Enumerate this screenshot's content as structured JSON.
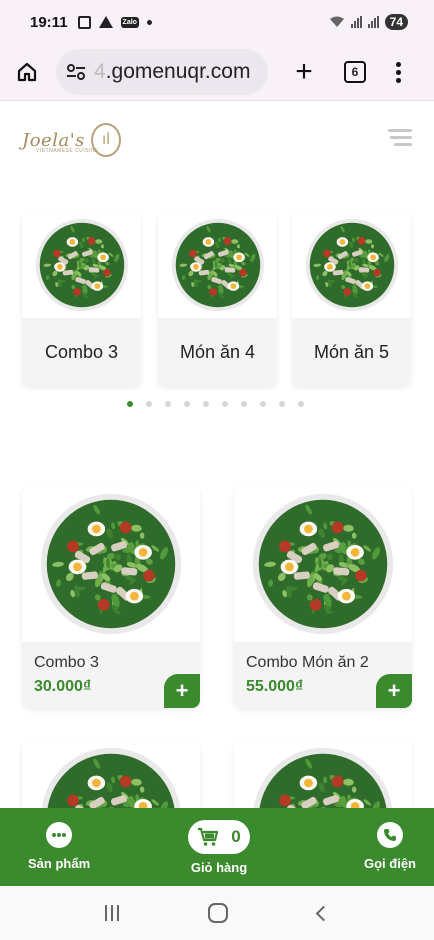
{
  "status_bar": {
    "time": "19:11",
    "battery": "74",
    "icons": [
      "screenshot-icon",
      "warning-icon",
      "zalo-icon",
      "dot-icon",
      "wifi-icon",
      "signal-icon",
      "battery-icon"
    ]
  },
  "browser": {
    "url_prefix": "",
    "url": "gomenuqr.com",
    "url_visible": ".gomenuqr.com",
    "tab_count": "6"
  },
  "header": {
    "logo_text": "Joela's",
    "logo_sub": "VIETNAMESE CUISINE"
  },
  "carousel": {
    "items": [
      {
        "label": "Combo 3"
      },
      {
        "label": "Món ăn 4"
      },
      {
        "label": "Món ăn 5"
      }
    ],
    "dot_count": 10,
    "active_dot": 0
  },
  "products": [
    {
      "name": "Combo 3",
      "price": "30.000₫"
    },
    {
      "name": "Combo Món ăn 2",
      "price": "55.000₫"
    },
    {
      "name": "",
      "price": ""
    },
    {
      "name": "",
      "price": ""
    }
  ],
  "action_bar": {
    "products_label": "Sản phẩm",
    "cart_label": "Giỏ hàng",
    "cart_count": "0",
    "call_label": "Gọi điện"
  },
  "colors": {
    "accent": "#3b8a2d",
    "gold": "#a38b5e"
  }
}
